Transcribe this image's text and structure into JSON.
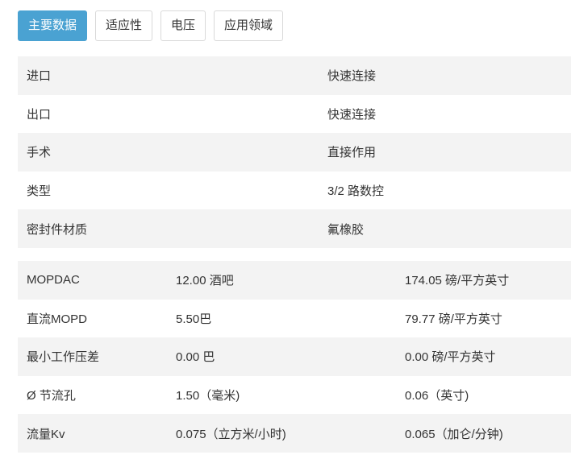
{
  "tabs": [
    {
      "label": "主要数据",
      "active": true
    },
    {
      "label": "适应性",
      "active": false
    },
    {
      "label": "电压",
      "active": false
    },
    {
      "label": "应用领域",
      "active": false
    }
  ],
  "spec_table": {
    "rows": [
      {
        "label": "进口",
        "value": "快速连接"
      },
      {
        "label": "出口",
        "value": "快速连接"
      },
      {
        "label": "手术",
        "value": "直接作用"
      },
      {
        "label": "类型",
        "value": "3/2 路数控"
      },
      {
        "label": "密封件材质",
        "value": "氟橡胶"
      }
    ]
  },
  "pressure_table": {
    "rows": [
      {
        "label": "MOPDAC",
        "metric": "12.00 酒吧",
        "imperial": "174.05 磅/平方英寸"
      },
      {
        "label": "直流MOPD",
        "metric": "5.50巴",
        "imperial": "79.77 磅/平方英寸"
      },
      {
        "label": "最小工作压差",
        "metric": "0.00 巴",
        "imperial": "0.00 磅/平方英寸"
      },
      {
        "label": "Ø 节流孔",
        "metric": "1.50（毫米)",
        "imperial": "0.06（英寸)"
      },
      {
        "label": "流量Kv",
        "metric": "0.075（立方米/小时)",
        "imperial": "0.065（加仑/分钟)"
      }
    ]
  },
  "colors": {
    "accent": "#4aa2d2",
    "row_stripe": "#f3f3f3",
    "text": "#333333"
  }
}
